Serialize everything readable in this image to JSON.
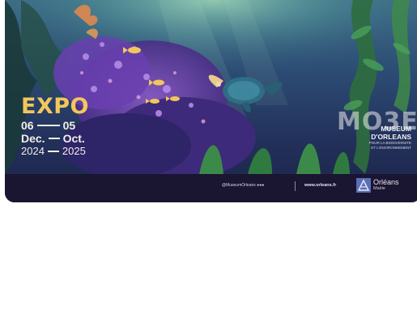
{
  "expo": {
    "title": "EXPO",
    "start_day": "06",
    "end_day": "05",
    "start_month": "Dec.",
    "end_month": "Oct.",
    "start_year": "2024",
    "end_year": "2025"
  },
  "museum": {
    "logo_text": "MO3E",
    "name_line1": "MUSEUM",
    "name_line2": "D'ORLEANS",
    "tagline_line1": "POUR LA BIODIVERSITE",
    "tagline_line2": "ET L'ENVIRONNEMENT"
  },
  "footer": {
    "social": "@MuseumOrleans",
    "social_icons": [
      "facebook-icon",
      "instagram-icon",
      "linkedin-icon"
    ],
    "url": "www.orleans.fr",
    "city_name": "Orléans",
    "city_role": "Mairie"
  },
  "colors": {
    "title_gold": "#f2c75a",
    "footer_bg": "#1a1531",
    "deep_water": "#1e2a4a"
  }
}
